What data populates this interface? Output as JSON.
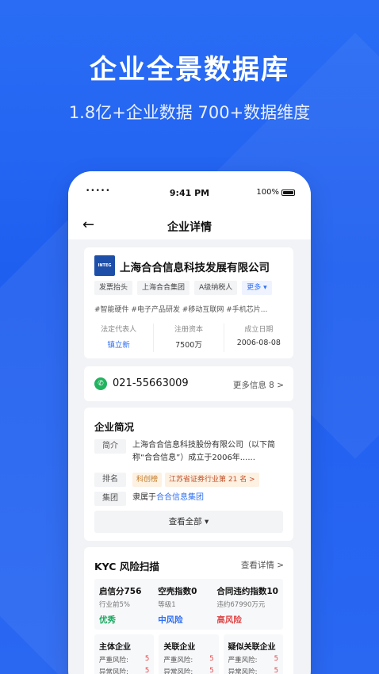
{
  "hero": {
    "title": "企业全景数据库",
    "subtitle": "1.8亿+企业数据 700+数据维度"
  },
  "status_bar": {
    "signal": "•••••",
    "time": "9:41 PM",
    "battery": "100%"
  },
  "nav": {
    "back_icon": "←",
    "title": "企业详情"
  },
  "company": {
    "logo_text": "INTEG",
    "name": "上海合合信息科技发展有限公司",
    "tags": [
      "发票抬头",
      "上海合合集团",
      "A级纳税人"
    ],
    "more_tag": "更多 ▾",
    "hashtags": "#智能硬件 #电子产品研发 #移动互联网 #手机芯片...",
    "facts": [
      {
        "label": "法定代表人",
        "value": "镇立新"
      },
      {
        "label": "注册资本",
        "value": "7500万"
      },
      {
        "label": "成立日期",
        "value": "2006-08-08"
      }
    ]
  },
  "contact": {
    "phone_icon": "phone-icon",
    "phone": "021-55663009",
    "more_info": "更多信息 8 >"
  },
  "profile": {
    "title": "企业简况",
    "intro_label": "简介",
    "intro_text": "上海合合信息科技股份有限公司（以下简称“合合信息”）成立于2006年......",
    "rank_label": "排名",
    "rank_badge": "科创榜",
    "rank_text": "江苏省证券行业第 21 名 >",
    "group_label": "集团",
    "group_prefix": "隶属于",
    "group_link": "合合信息集团",
    "see_all": "查看全部 ▾"
  },
  "kyc": {
    "title": "KYC 风险扫描",
    "more": "查看详情 >",
    "scores": [
      {
        "name": "启信分756",
        "sub": "行业前5%",
        "level": "优秀"
      },
      {
        "name": "空壳指数0",
        "sub": "等级1",
        "level": "中风险"
      },
      {
        "name": "合同违约指数10",
        "sub": "违约67990万元",
        "level": "高风险"
      }
    ],
    "risk_boxes": [
      {
        "title": "主体企业",
        "l1": "严重风险:",
        "v1": "5",
        "l2": "异常风险:",
        "v2": "5"
      },
      {
        "title": "关联企业",
        "l1": "严重风险:",
        "v1": "5",
        "l2": "异常风险:",
        "v2": "5"
      },
      {
        "title": "疑似关联企业",
        "l1": "严重风险:",
        "v1": "5",
        "l2": "异常风险:",
        "v2": "5"
      }
    ]
  },
  "colors": {
    "background": "#1f5ff0",
    "accent_blue": "#2f6ff2",
    "good": "#14a85c",
    "danger": "#e04646"
  }
}
